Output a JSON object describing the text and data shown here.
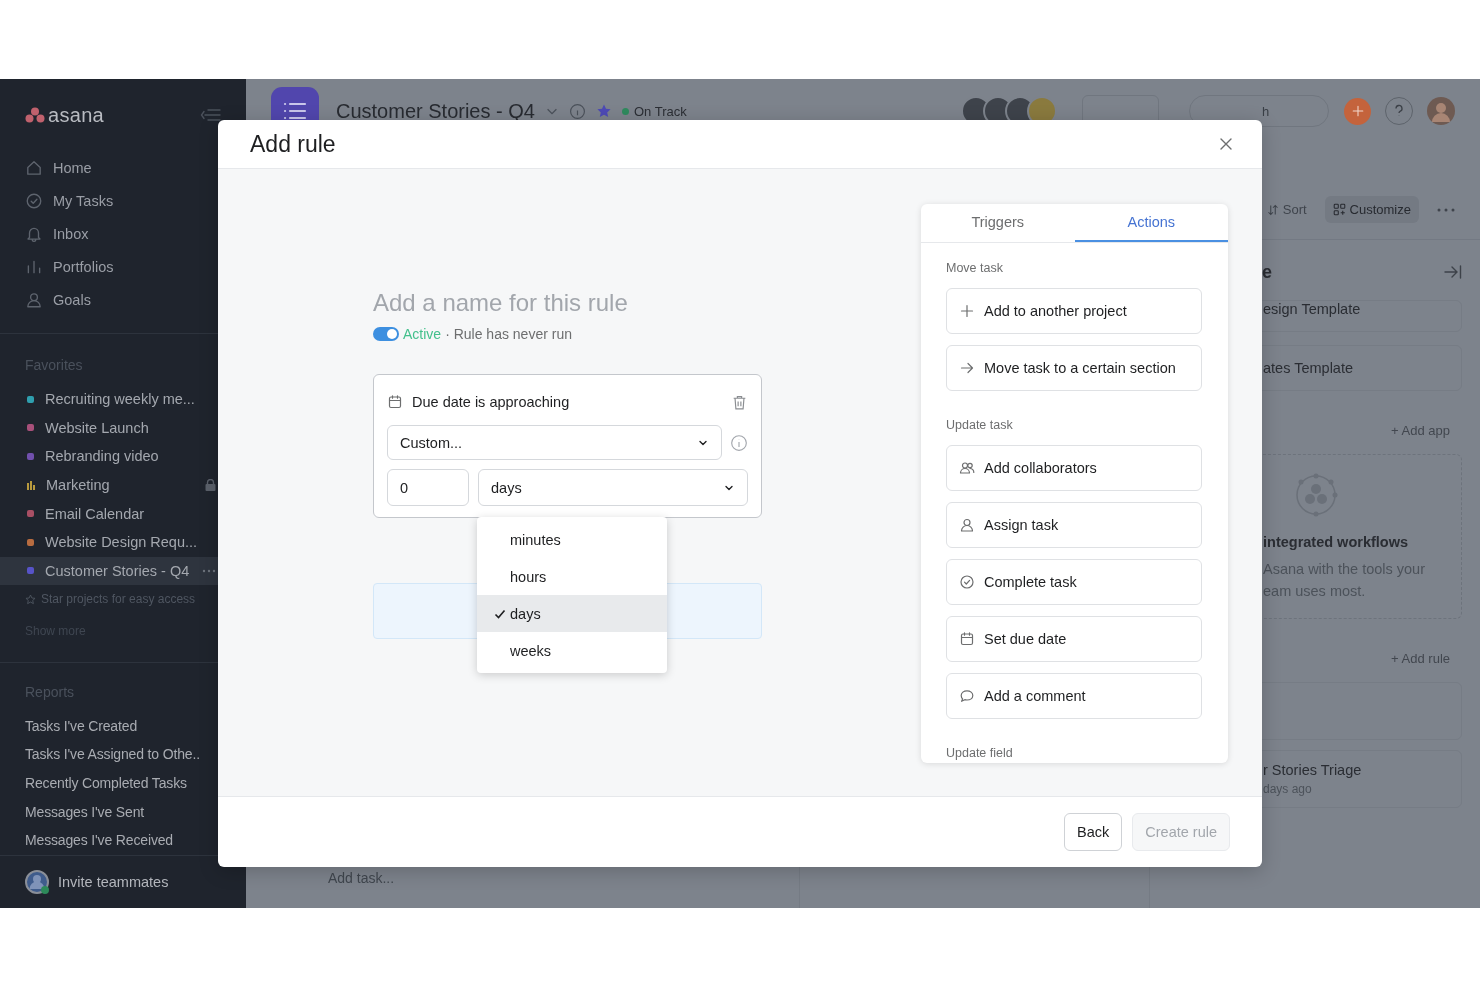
{
  "sidebar": {
    "logo": "asana",
    "nav": [
      {
        "label": "Home",
        "kind": "home"
      },
      {
        "label": "My Tasks",
        "kind": "check"
      },
      {
        "label": "Inbox",
        "kind": "bell"
      },
      {
        "label": "Portfolios",
        "kind": "bars"
      },
      {
        "label": "Goals",
        "kind": "person"
      }
    ],
    "favorites_heading": "Favorites",
    "favorites": [
      {
        "label": "Recruiting weekly me...",
        "kind": "square",
        "color": "#2f9fae",
        "locked": false,
        "selected": false
      },
      {
        "label": "Website Launch",
        "kind": "square",
        "color": "#a8507a",
        "locked": false,
        "selected": false
      },
      {
        "label": "Rebranding video",
        "kind": "square",
        "color": "#7150ad",
        "locked": false,
        "selected": false
      },
      {
        "label": "Marketing",
        "kind": "bars",
        "color": "#b89a3e",
        "locked": true,
        "selected": false
      },
      {
        "label": "Email Calendar",
        "kind": "square",
        "color": "#a84f64",
        "locked": false,
        "selected": false
      },
      {
        "label": "Website Design Requ...",
        "kind": "square",
        "color": "#b86c40",
        "locked": false,
        "selected": false
      },
      {
        "label": "Customer Stories - Q4",
        "kind": "square",
        "color": "#5753c8",
        "locked": false,
        "selected": true
      }
    ],
    "star_hint": "Star projects for easy access",
    "show_more": "Show more",
    "reports_heading": "Reports",
    "reports": [
      "Tasks I've Created",
      "Tasks I've Assigned to Othe..",
      "Recently Completed Tasks",
      "Messages I've Sent",
      "Messages I've Received"
    ],
    "invite": "Invite teammates"
  },
  "project_header": {
    "title": "Customer Stories - Q4",
    "status": "On Track",
    "search_fragment": "h"
  },
  "toolbar": {
    "sort": "Sort",
    "customize": "Customize"
  },
  "board": {
    "add_task": "Add task..."
  },
  "details_panel": {
    "heading_fragment": "e",
    "templates": [
      "esign Template",
      "ates Template"
    ],
    "add_app": "+ Add app",
    "apps_title": "integrated workflows",
    "apps_text": [
      "Asana with the tools your",
      "eam uses most."
    ],
    "add_rule": "+ Add rule",
    "rules": [
      {
        "title": "r Stories Triage",
        "meta": "days ago"
      }
    ]
  },
  "modal": {
    "title": "Add rule",
    "name_placeholder": "Add a name for this rule",
    "rule_status": {
      "on": true,
      "label": "Active",
      "status": "· Rule has never run"
    },
    "trigger": {
      "title": "Due date is approaching",
      "mode": "Custom...",
      "amount": "0",
      "unit": "days",
      "unit_options": [
        {
          "label": "minutes",
          "selected": false
        },
        {
          "label": "hours",
          "selected": false
        },
        {
          "label": "days",
          "selected": true
        },
        {
          "label": "weeks",
          "selected": false
        }
      ]
    },
    "panel": {
      "tabs": [
        {
          "label": "Triggers",
          "selected": false
        },
        {
          "label": "Actions",
          "selected": true
        }
      ],
      "sections": [
        {
          "heading": "Move task",
          "actions": [
            {
              "label": "Add to another project",
              "kind": "plus"
            },
            {
              "label": "Move task to a certain section",
              "kind": "arrow"
            }
          ]
        },
        {
          "heading": "Update task",
          "actions": [
            {
              "label": "Add collaborators",
              "kind": "people"
            },
            {
              "label": "Assign task",
              "kind": "person"
            },
            {
              "label": "Complete task",
              "kind": "check"
            },
            {
              "label": "Set due date",
              "kind": "calendar"
            },
            {
              "label": "Add a comment",
              "kind": "comment"
            }
          ]
        },
        {
          "heading": "Update field"
        }
      ]
    },
    "buttons": [
      {
        "label": "Back",
        "disabled": false
      },
      {
        "label": "Create rule",
        "disabled": true
      }
    ]
  }
}
